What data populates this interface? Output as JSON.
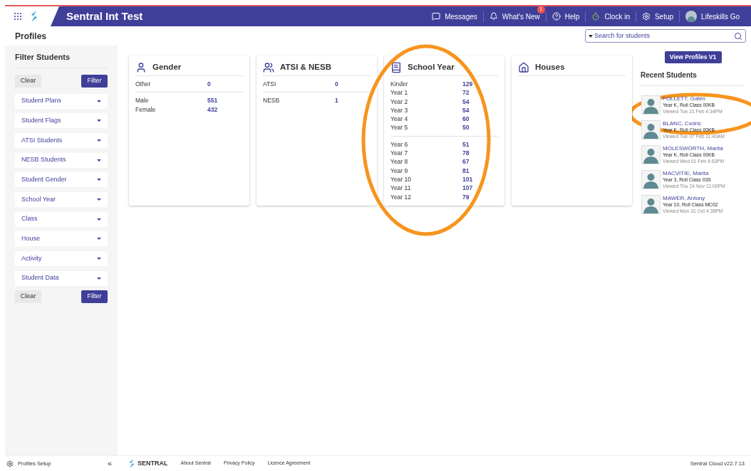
{
  "header": {
    "title": "Sentral Int Test",
    "nav": [
      {
        "kind": "messages",
        "label": "Messages"
      },
      {
        "kind": "news",
        "label": "What's New",
        "badge": "1"
      },
      {
        "kind": "help",
        "label": "Help"
      },
      {
        "kind": "clock",
        "label": "Clock in"
      },
      {
        "kind": "setup",
        "label": "Setup"
      },
      {
        "kind": "user",
        "label": "Lifeskills Go"
      }
    ]
  },
  "page_title": "Profiles",
  "search": {
    "placeholder": "Search for students"
  },
  "sidebar": {
    "title": "Filter Students",
    "top_buttons": {
      "clear": "Clear",
      "filter": "Filter"
    },
    "bottom_buttons": {
      "clear": "Clear",
      "filter": "Filter"
    },
    "filters": [
      "Student Plans",
      "Student Flags",
      "ATSI Students",
      "NESB Students",
      "Student Gender",
      "School Year",
      "Class",
      "House",
      "Activity",
      "Student Data"
    ],
    "setup": "Profiles Setup",
    "collapse": "«"
  },
  "cards": [
    {
      "kind": "gender",
      "title": "Gender",
      "groups": [
        [
          {
            "label": "Other",
            "value": "0"
          }
        ],
        [
          {
            "label": "Male",
            "value": "551"
          },
          {
            "label": "Female",
            "value": "432"
          }
        ]
      ]
    },
    {
      "kind": "atsi",
      "title": "ATSI & NESB",
      "groups": [
        [
          {
            "label": "ATSI",
            "value": "0"
          }
        ],
        [
          {
            "label": "NESB",
            "value": "1"
          }
        ]
      ]
    },
    {
      "kind": "year",
      "title": "School Year",
      "groups": [
        [
          {
            "label": "Kinder",
            "value": "129"
          },
          {
            "label": "Year 1",
            "value": "72"
          },
          {
            "label": "Year 2",
            "value": "54"
          },
          {
            "label": "Year 3",
            "value": "54"
          },
          {
            "label": "Year 4",
            "value": "60"
          },
          {
            "label": "Year 5",
            "value": "50"
          }
        ],
        [
          {
            "label": "Year 6",
            "value": "51"
          },
          {
            "label": "Year 7",
            "value": "78"
          },
          {
            "label": "Year 8",
            "value": "67"
          },
          {
            "label": "Year 9",
            "value": "81"
          },
          {
            "label": "Year 10",
            "value": "101"
          },
          {
            "label": "Year 11",
            "value": "107"
          },
          {
            "label": "Year 12",
            "value": "79"
          }
        ]
      ]
    },
    {
      "kind": "houses",
      "title": "Houses"
    }
  ],
  "view_button": "View Profiles V1",
  "recent": {
    "title": "Recent Students",
    "students": [
      {
        "name": "FOLLETT, Galen",
        "detail": "Year K, Roll Class 00KB",
        "viewed": "Viewed Tue 21 Feb 4:34PM"
      },
      {
        "name": "BLANC, Cedric",
        "detail": "Year K, Roll Class 00KB",
        "viewed": "Viewed Tue 07 Feb 11:40AM"
      },
      {
        "name": "MOLESWORTH, Marita",
        "detail": "Year K, Roll Class 00KB",
        "viewed": "Viewed Wed 01 Feb 4:53PM"
      },
      {
        "name": "MACVITIE, Marita",
        "detail": "Year 3, Roll Class 03S",
        "viewed": "Viewed Thu 24 Nov 11:00PM"
      },
      {
        "name": "MAWER, Antony",
        "detail": "Year 10, Roll Class MC02",
        "viewed": "Viewed Mon 31 Oct 4:38PM"
      }
    ]
  },
  "footer": {
    "brand": "SENTRAL",
    "links": [
      "About Sentral",
      "Privacy Policy",
      "Licence Agreement"
    ],
    "version": "Sentral Cloud v22.7.13"
  },
  "annotations": [
    {
      "kind": "ellipse"
    },
    {
      "kind": "ellipse"
    }
  ]
}
